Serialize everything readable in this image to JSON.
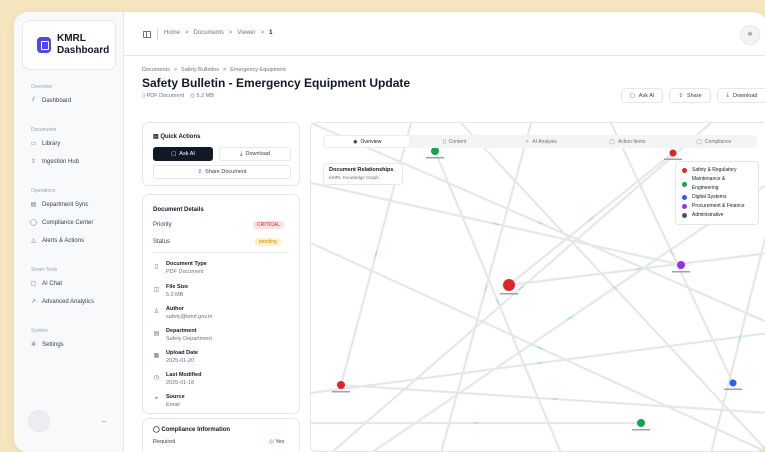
{
  "sidebar": {
    "brand": {
      "line1": "KMRL",
      "line2": "Dashboard"
    },
    "sections": [
      {
        "label": "Overview",
        "items": [
          {
            "label": "Dashboard",
            "icon": "chart-icon"
          }
        ]
      },
      {
        "label": "Documents",
        "items": [
          {
            "label": "Library",
            "icon": "folder-icon"
          },
          {
            "label": "Ingestion Hub",
            "icon": "upload-icon"
          }
        ]
      },
      {
        "label": "Operations",
        "items": [
          {
            "label": "Department Sync",
            "icon": "building-icon"
          },
          {
            "label": "Compliance Center",
            "icon": "shield-icon"
          },
          {
            "label": "Alerts & Actions",
            "icon": "alert-icon"
          }
        ]
      },
      {
        "label": "Smart Tools",
        "items": [
          {
            "label": "AI Chat",
            "icon": "chat-icon"
          },
          {
            "label": "Advanced Analytics",
            "icon": "trend-icon"
          }
        ]
      },
      {
        "label": "System",
        "items": [
          {
            "label": "Settings",
            "icon": "gear-icon"
          }
        ]
      }
    ],
    "collapse_label": "–"
  },
  "topbar": {
    "breadcrumb": [
      "Home",
      "Documents",
      "Viewer",
      "1"
    ],
    "separator": ">"
  },
  "page": {
    "crumbs": [
      "Documents",
      "Safety Bulletins",
      "Emergency Equipment"
    ],
    "title": "Safety Bulletin - Emergency Equipment Update",
    "type": "PDF Document",
    "size": "5.2 MB",
    "actions": {
      "ask_ai": "Ask AI",
      "share": "Share",
      "download": "Download"
    }
  },
  "quick_actions": {
    "title": "Quick Actions",
    "ask_ai": "Ask AI",
    "download": "Download",
    "share": "Share Document"
  },
  "document_details": {
    "title": "Document Details",
    "priority_label": "Priority",
    "priority_value": "CRITICAL",
    "status_label": "Status",
    "status_value": "pending",
    "fields": [
      {
        "label": "Document Type",
        "value": "PDF Document",
        "icon": "file-icon"
      },
      {
        "label": "File Size",
        "value": "5.2 MB",
        "icon": "disk-icon"
      },
      {
        "label": "Author",
        "value": "safety@kmrl.gov.in",
        "icon": "user-icon"
      },
      {
        "label": "Department",
        "value": "Safety Department",
        "icon": "building-icon"
      },
      {
        "label": "Upload Date",
        "value": "2025-01-20",
        "icon": "calendar-icon"
      },
      {
        "label": "Last Modified",
        "value": "2025-01-18",
        "icon": "clock-icon"
      },
      {
        "label": "Source",
        "value": "Email",
        "icon": "pin-icon"
      }
    ]
  },
  "compliance": {
    "title": "Compliance Information",
    "required_label": "Required",
    "required_value": "Yes"
  },
  "viewer": {
    "tabs": [
      "Overview",
      "Content",
      "AI Analysis",
      "Action Items",
      "Compliance"
    ],
    "active_tab": "Overview",
    "graph_title": "Document Relationships",
    "graph_subtitle": "KMRL Knowledge Graph",
    "legend": [
      {
        "label": "Safety & Regulatory",
        "color": "#dc2626"
      },
      {
        "label": "Maintenance & Engineering",
        "color": "#16a34a"
      },
      {
        "label": "Digital Systems",
        "color": "#2563eb"
      },
      {
        "label": "Procurement & Finance",
        "color": "#9333ea"
      },
      {
        "label": "Administrative",
        "color": "#4b5563"
      }
    ]
  },
  "colors": {
    "accent": "#4f46e5",
    "critical": "#dc2626",
    "pending": "#ca8a04",
    "success": "#16a34a"
  }
}
